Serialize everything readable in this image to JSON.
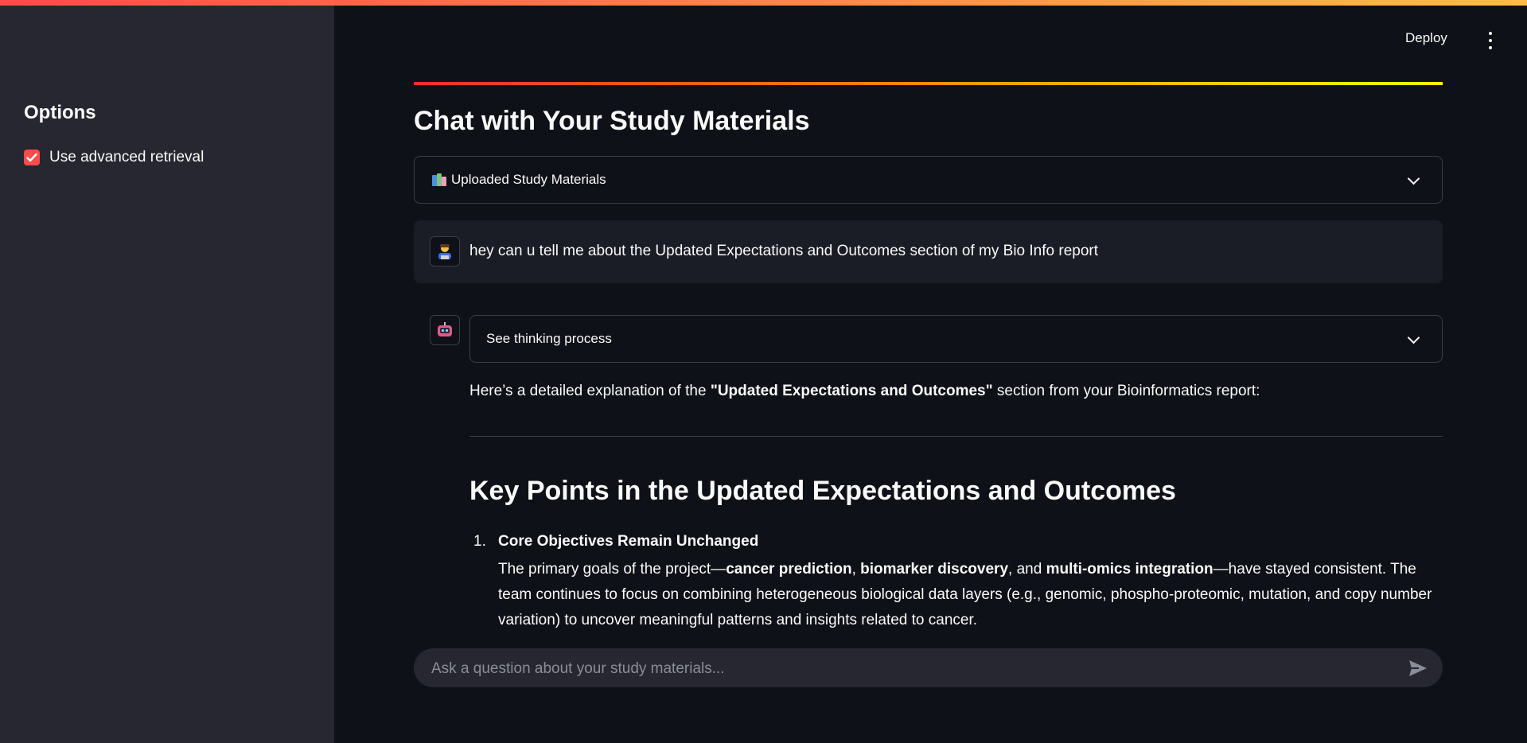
{
  "sidebar": {
    "title": "Options",
    "checkbox": {
      "label": "Use advanced retrieval",
      "checked": true
    }
  },
  "header": {
    "deploy_label": "Deploy",
    "menu_icon": "kebab-menu-icon"
  },
  "main": {
    "title": "Chat with Your Study Materials",
    "uploaded_expander": {
      "label": "Uploaded Study Materials",
      "icon": "books-icon"
    },
    "messages": {
      "user": {
        "avatar_icon": "user-avatar-icon",
        "text": "hey can u tell me about the Updated Expectations and Outcomes section of my Bio Info report"
      },
      "assistant": {
        "avatar_icon": "robot-avatar-icon",
        "thinking_label": "See thinking process",
        "intro": {
          "before": "Here’s a detailed explanation of the ",
          "bold": "\"Updated Expectations and Outcomes\"",
          "after": " section from your Bioinformatics report:"
        },
        "heading": "Key Points in the Updated Expectations and Outcomes",
        "items": [
          {
            "number": "1.",
            "title": "Core Objectives Remain Unchanged",
            "body_parts": {
              "p1": "The primary goals of the project—",
              "b1": "cancer prediction",
              "p2": ", ",
              "b2": "biomarker discovery",
              "p3": ", and ",
              "b3": "multi-omics integration",
              "p4": "—have stayed consistent. The team continues to focus on combining heterogeneous biological data layers (e.g., genomic, phospho-proteomic, mutation, and copy number variation) to uncover meaningful patterns and insights related to cancer."
            }
          }
        ]
      }
    },
    "chat_input": {
      "placeholder": "Ask a question about your study materials...",
      "value": ""
    }
  },
  "colors": {
    "accent": "#ff4b4b",
    "background": "#0e1117",
    "sidebar": "#262730"
  }
}
